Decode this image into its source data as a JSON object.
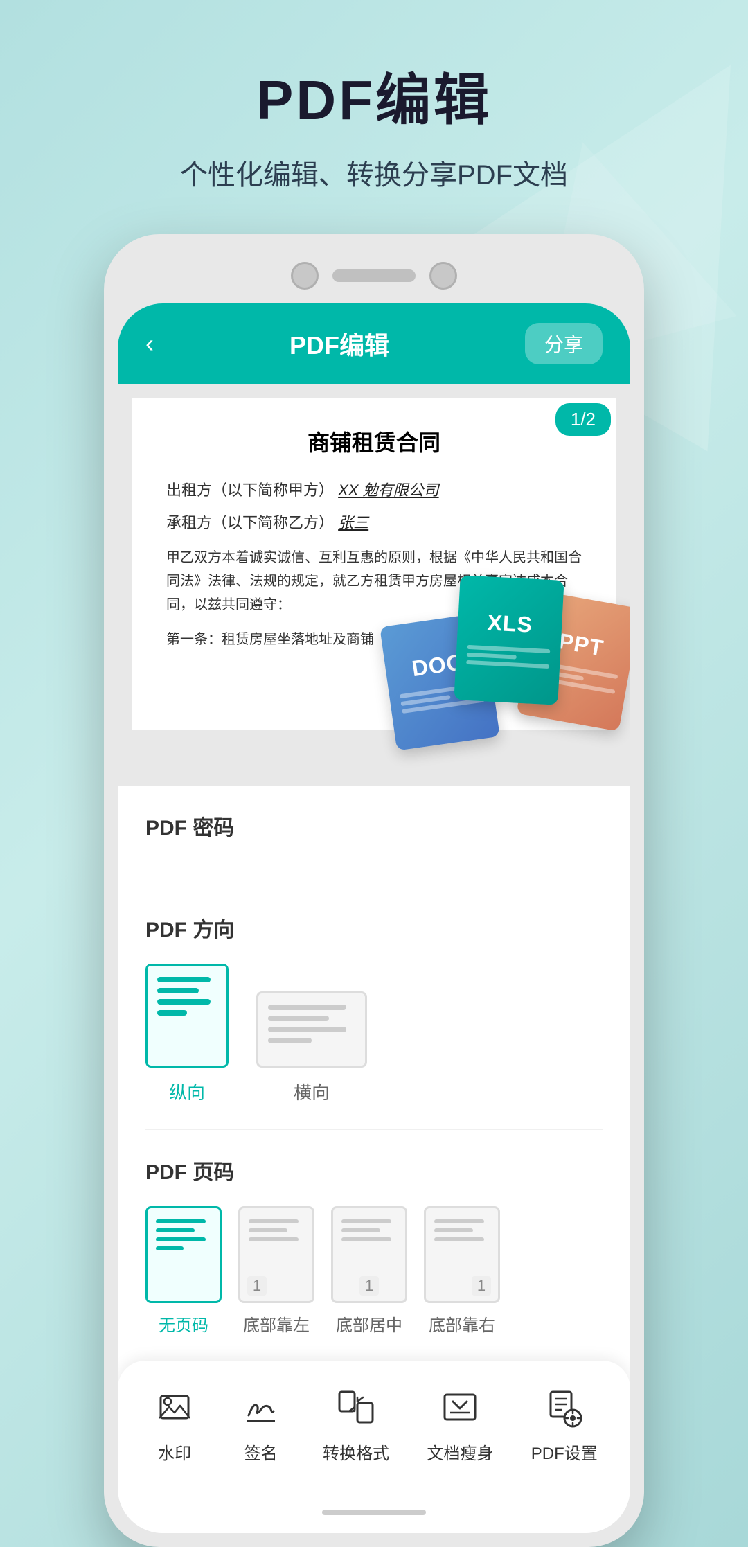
{
  "header": {
    "title": "PDF编辑",
    "subtitle": "个性化编辑、转换分享PDF文档"
  },
  "app_bar": {
    "back_icon": "‹",
    "title": "PDF编辑",
    "share_btn": "分享"
  },
  "pdf_document": {
    "page_badge": "1/2",
    "doc_title": "商铺租赁合同",
    "line1_label": "出租方（以下简称甲方）",
    "line1_value": "XX 勉有限公司",
    "line2_label": "承租方（以下简称乙方）",
    "line2_value": "张三",
    "body_text": "甲乙双方本着诚实诚信、互利互惠的原则，根据《中华人民共和国合同法》法律、法规的规定，就乙方租赁甲方房屋相关事宜达成本合同，以兹共同遵守：",
    "article1": "第一条：租赁房屋坐落地址及商铺"
  },
  "file_formats": [
    {
      "label": "DOC",
      "color": "#4472c4"
    },
    {
      "label": "XLS",
      "color": "#00968a"
    },
    {
      "label": "PPT",
      "color": "#d4785a"
    }
  ],
  "pdf_password_section": {
    "title": "PDF 密码"
  },
  "pdf_direction_section": {
    "title": "PDF 方向",
    "options": [
      {
        "label": "纵向",
        "active": true
      },
      {
        "label": "横向",
        "active": false
      }
    ]
  },
  "pdf_pagecode_section": {
    "title": "PDF 页码",
    "options": [
      {
        "label": "无页码",
        "active": true,
        "has_number": false
      },
      {
        "label": "底部靠左",
        "active": false,
        "has_number": true,
        "number": "1",
        "position": "left"
      },
      {
        "label": "底部居中",
        "active": false,
        "has_number": true,
        "number": "1",
        "position": "center"
      },
      {
        "label": "底部靠右",
        "active": false,
        "has_number": true,
        "number": "1",
        "position": "right"
      }
    ]
  },
  "toolbar": {
    "items": [
      {
        "label": "水印",
        "icon": "watermark"
      },
      {
        "label": "签名",
        "icon": "signature"
      },
      {
        "label": "转换格式",
        "icon": "convert"
      },
      {
        "label": "文档瘦身",
        "icon": "compress"
      },
      {
        "label": "PDF设置",
        "icon": "settings"
      }
    ]
  },
  "colors": {
    "teal": "#00b8a9",
    "dark": "#1a1a2e",
    "bg": "#b8e0e0"
  }
}
